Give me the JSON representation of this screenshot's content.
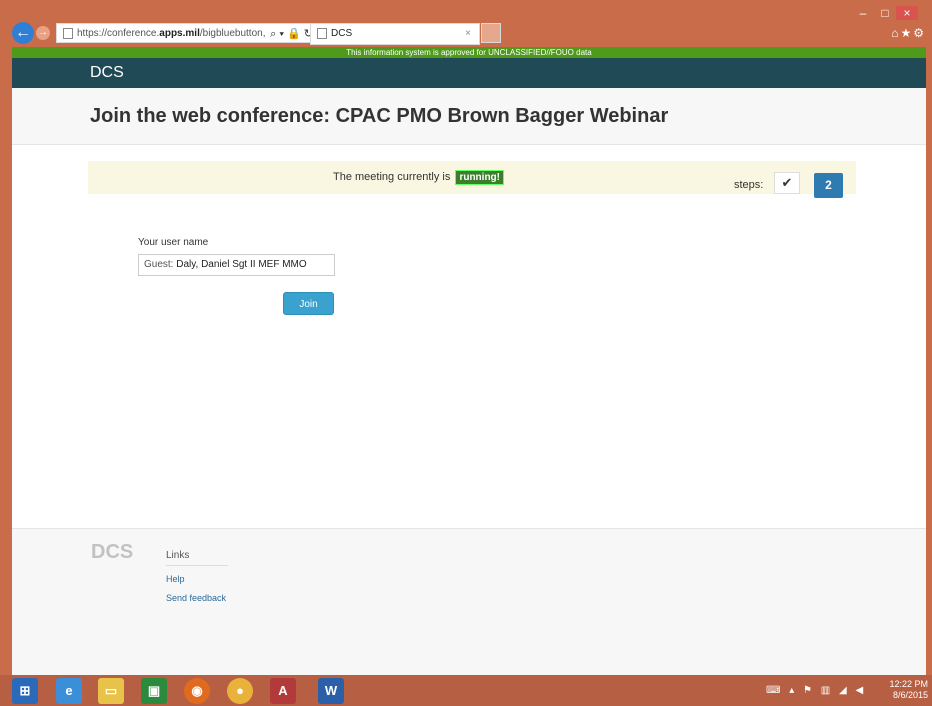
{
  "browser": {
    "url_prefix": "https://conference.",
    "url_domain": "apps.mil",
    "url_suffix": "/bigbluebutton,",
    "url_tools": "⌕ ▾ 🔒 ↻",
    "tab_title": "DCS",
    "tab_close": "×"
  },
  "window": {
    "minimize": "–",
    "maximize": "□",
    "close": "×",
    "right_icons": "⌂★⚙"
  },
  "banner": {
    "text": "This information system is approved for UNCLASSIFIED//FOUO data"
  },
  "nav": {
    "brand": "DCS"
  },
  "page": {
    "title": "Join the web conference: CPAC PMO Brown Bagger Webinar"
  },
  "status": {
    "text": "The meeting currently is",
    "badge": "running!",
    "steps_label": "steps:",
    "step1": "✔",
    "step2": "2"
  },
  "form": {
    "user_label": "Your user name",
    "guest_prefix": "Guest:",
    "user_value": "Daly, Daniel Sgt II MEF MMO",
    "join_label": "Join"
  },
  "footer": {
    "logo": "DCS",
    "links_heading": "Links",
    "links": [
      "Help",
      "Send feedback"
    ]
  },
  "taskbar": {
    "apps": [
      "windows-logo",
      "ie-icon",
      "file-explorer-icon",
      "store-icon",
      "firefox-icon",
      "chrome-icon",
      "access-icon",
      "word-icon"
    ],
    "time": "12:22 PM",
    "date": "8/6/2015"
  }
}
